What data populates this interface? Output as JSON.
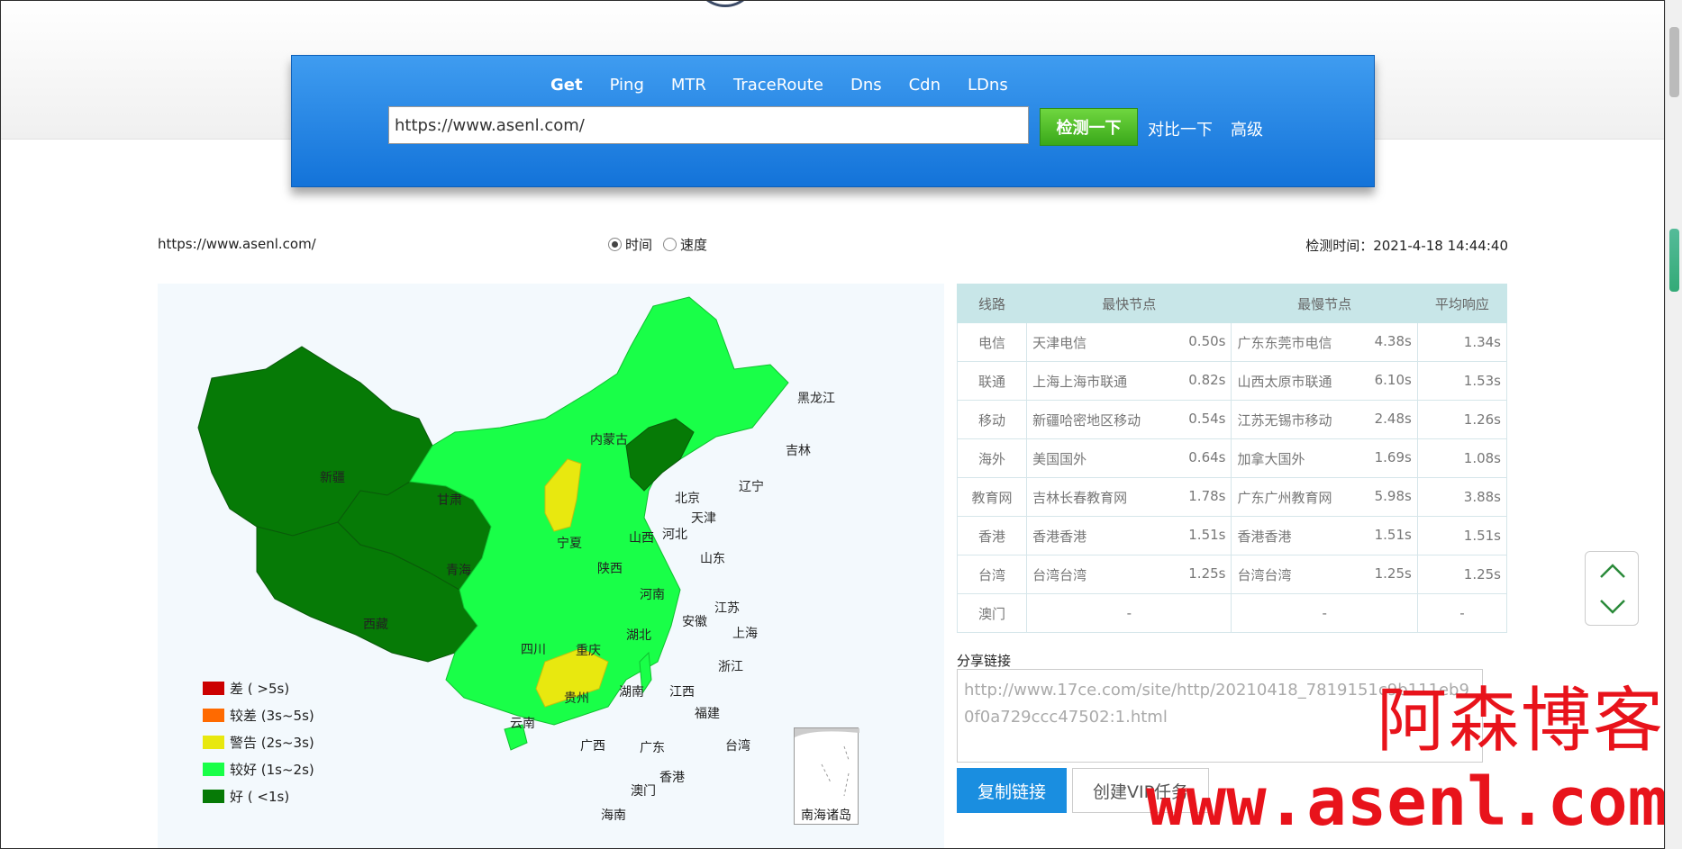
{
  "tabs": [
    {
      "label": "Get",
      "active": true
    },
    {
      "label": "Ping",
      "active": false
    },
    {
      "label": "MTR",
      "active": false
    },
    {
      "label": "TraceRoute",
      "active": false
    },
    {
      "label": "Dns",
      "active": false
    },
    {
      "label": "Cdn",
      "active": false
    },
    {
      "label": "LDns",
      "active": false
    }
  ],
  "search": {
    "value": "https://www.asenl.com/",
    "check_label": "检测一下",
    "compare_label": "对比一下",
    "advanced_label": "高级"
  },
  "info": {
    "url": "https://www.asenl.com/",
    "radio_time": "时间",
    "radio_speed": "速度",
    "selected": "时间",
    "check_time": "检测时间：2021-4-18 14:44:40"
  },
  "map": {
    "provinces": [
      "新疆",
      "西藏",
      "青海",
      "甘肃",
      "内蒙古",
      "黑龙江",
      "吉林",
      "辽宁",
      "北京",
      "天津",
      "河北",
      "山西",
      "宁夏",
      "陕西",
      "山东",
      "河南",
      "江苏",
      "安徽",
      "上海",
      "湖北",
      "四川",
      "重庆",
      "浙江",
      "贵州",
      "湖南",
      "江西",
      "福建",
      "云南",
      "广西",
      "广东",
      "台湾",
      "香港",
      "澳门",
      "海南"
    ],
    "south_sea_label": "南海诸岛",
    "colors": {
      "bad": "#cc0000",
      "poor": "#ff6600",
      "warn": "#e8e80f",
      "good": "#19ff48",
      "best": "#067a06"
    }
  },
  "legend": [
    {
      "label": "差 ( >5s)",
      "color": "#cc0000"
    },
    {
      "label": "较差 (3s~5s)",
      "color": "#ff6a00"
    },
    {
      "label": "警告 (2s~3s)",
      "color": "#e8e80f"
    },
    {
      "label": "较好 (1s~2s)",
      "color": "#19ff48"
    },
    {
      "label": "好 ( <1s)",
      "color": "#067a06"
    }
  ],
  "table": {
    "headers": [
      "线路",
      "最快节点",
      "最慢节点",
      "平均响应"
    ],
    "rows": [
      {
        "line": "电信",
        "fast_node": "天津电信",
        "fast_time": "0.50s",
        "slow_node": "广东东莞市电信",
        "slow_time": "4.38s",
        "avg": "1.34s"
      },
      {
        "line": "联通",
        "fast_node": "上海上海市联通",
        "fast_time": "0.82s",
        "slow_node": "山西太原市联通",
        "slow_time": "6.10s",
        "avg": "1.53s"
      },
      {
        "line": "移动",
        "fast_node": "新疆哈密地区移动",
        "fast_time": "0.54s",
        "slow_node": "江苏无锡市移动",
        "slow_time": "2.48s",
        "avg": "1.26s"
      },
      {
        "line": "海外",
        "fast_node": "美国国外",
        "fast_time": "0.64s",
        "slow_node": "加拿大国外",
        "slow_time": "1.69s",
        "avg": "1.08s"
      },
      {
        "line": "教育网",
        "fast_node": "吉林长春教育网",
        "fast_time": "1.78s",
        "slow_node": "广东广州教育网",
        "slow_time": "5.98s",
        "avg": "3.88s"
      },
      {
        "line": "香港",
        "fast_node": "香港香港",
        "fast_time": "1.51s",
        "slow_node": "香港香港",
        "slow_time": "1.51s",
        "avg": "1.51s"
      },
      {
        "line": "台湾",
        "fast_node": "台湾台湾",
        "fast_time": "1.25s",
        "slow_node": "台湾台湾",
        "slow_time": "1.25s",
        "avg": "1.25s"
      },
      {
        "line": "澳门",
        "fast_node": "-",
        "fast_time": "",
        "slow_node": "-",
        "slow_time": "",
        "avg": "-"
      }
    ]
  },
  "share": {
    "title": "分享链接",
    "link": "http://www.17ce.com/site/http/20210418_7819151c9b111eb90f0a729ccc47502:1.html",
    "copy_label": "复制链接",
    "vip_label": "创建VIP任务"
  },
  "watermark": {
    "cn": "阿森博客",
    "en": "www.asenl.com"
  }
}
